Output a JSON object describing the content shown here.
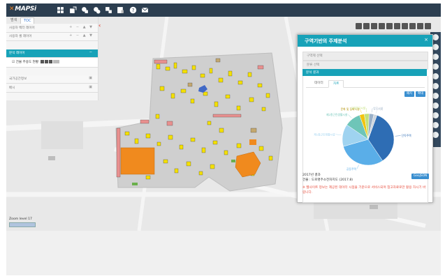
{
  "app": {
    "logo_text": "MAPSi"
  },
  "sidebar": {
    "tabs": [
      {
        "label": "범색"
      },
      {
        "label": "TOC"
      }
    ],
    "rows": [
      {
        "label": "사용자 벡터 레이어",
        "controls": "+ − ▲ ▼"
      },
      {
        "label": "사용자 셀 레이어",
        "controls": "+ − ▲ ▼"
      },
      {
        "label": "분석 레이어",
        "controls": "−"
      },
      {
        "label": "건물 주용도 현황",
        "controls": ""
      },
      {
        "label": "국가공간정보",
        "controls": ""
      },
      {
        "label": "배시",
        "controls": ""
      }
    ],
    "collapse_label": "‹"
  },
  "map": {
    "zoom_label": "Zoom level 17"
  },
  "dialog": {
    "title": "구역기반의 주제분석",
    "close_label": "×",
    "field1_placeholder": "구역제 선택",
    "field2_placeholder": "분류 선택",
    "section_label": "분석 결과",
    "tabs": [
      {
        "label": "데이터"
      },
      {
        "label": "차트"
      }
    ],
    "btn1": "폐지",
    "btn2": "확대",
    "export_btn": "GeoJSON",
    "info_year": "2017년 결과",
    "info_source": "건물 : 도로명주소전자지도 (2017.8)",
    "warning": "※ 웹사이트 정보는 제공된 데이터 시점을 기준으로 서비스되며 참고자료로만 활용 하시기 바랍니다."
  },
  "chart_data": {
    "type": "pie",
    "categories": [
      "단독주택",
      "공동주택",
      "제1종근린생활시설",
      "제2종근린생활시설",
      "문화 및 집회시설",
      "교육연구시설",
      "업무시설",
      "기타"
    ],
    "values": [
      35,
      30,
      14,
      10,
      3,
      3,
      3,
      2
    ],
    "colors": [
      "#2e6db4",
      "#5aaee8",
      "#9fd3f0",
      "#6ec5b8",
      "#f1c40f",
      "#c2e07a",
      "#9ab0c8",
      "#cdd5dd"
    ]
  }
}
